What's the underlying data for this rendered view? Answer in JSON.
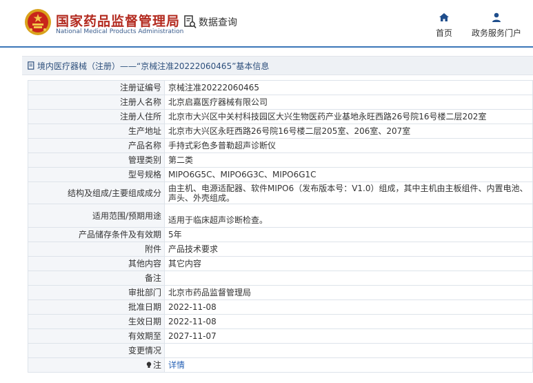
{
  "header": {
    "agency_cn": "国家药品监督管理局",
    "agency_en": "National Medical Products Administration",
    "query_label": "数据查询",
    "nav": [
      {
        "label": "首页",
        "icon": "home-icon"
      },
      {
        "label": "政务服务门户",
        "icon": "user-icon"
      }
    ]
  },
  "breadcrumb": "境内医疗器械（注册）——“京械注准20222060465”基本信息",
  "rows": [
    {
      "label": "注册证编号",
      "value": "京械注准20222060465"
    },
    {
      "label": "注册人名称",
      "value": "北京启嘉医疗器械有限公司"
    },
    {
      "label": "注册人住所",
      "value": "北京市大兴区中关村科技园区大兴生物医药产业基地永旺西路26号院16号楼二层202室"
    },
    {
      "label": "生产地址",
      "value": "北京市大兴区永旺西路26号院16号楼二层205室、206室、207室"
    },
    {
      "label": "产品名称",
      "value": "手持式彩色多普勒超声诊断仪"
    },
    {
      "label": "管理类别",
      "value": "第二类"
    },
    {
      "label": "型号规格",
      "value": "MIPO6G5C、MIPO6G3C、MIPO6G1C"
    },
    {
      "label": "结构及组成/主要组成成分",
      "value": "由主机、电源适配器、软件MIPO6（发布版本号：V1.0）组成，其中主机由主板组件、内置电池、声头、外壳组成。"
    },
    {
      "label": "适用范围/预期用途",
      "value": "适用于临床超声诊断检查。"
    },
    {
      "label": "产品储存条件及有效期",
      "value": "5年"
    },
    {
      "label": "附件",
      "value": "产品技术要求"
    },
    {
      "label": "其他内容",
      "value": "其它内容"
    },
    {
      "label": "备注",
      "value": ""
    },
    {
      "label": "审批部门",
      "value": "北京市药品监督管理局"
    },
    {
      "label": "批准日期",
      "value": "2022-11-08"
    },
    {
      "label": "生效日期",
      "value": "2022-11-08"
    },
    {
      "label": "有效期至",
      "value": "2027-11-07"
    },
    {
      "label": "变更情况",
      "value": ""
    },
    {
      "label": "注",
      "value": "详情"
    }
  ],
  "colors": {
    "brand_red": "#b32a1f",
    "accent_blue": "#3a76b8",
    "link": "#2a64b6"
  }
}
